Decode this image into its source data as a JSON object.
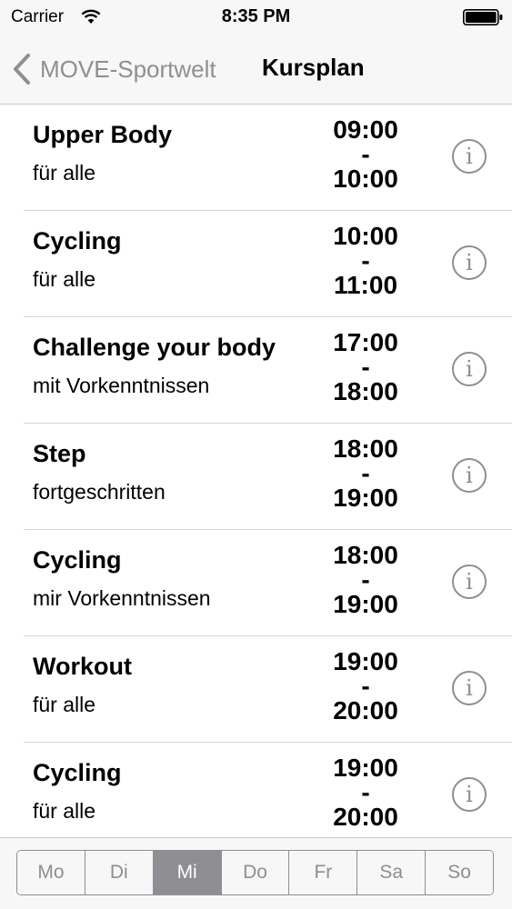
{
  "status_bar": {
    "carrier": "Carrier",
    "time": "8:35 PM"
  },
  "nav": {
    "back_label": "MOVE-Sportwelt",
    "title": "Kursplan"
  },
  "courses": [
    {
      "name": "Upper Body",
      "level": "für alle",
      "start": "09:00",
      "separator": "-",
      "end": "10:00"
    },
    {
      "name": "Cycling",
      "level": "für alle",
      "start": "10:00",
      "separator": "-",
      "end": "11:00"
    },
    {
      "name": "Challenge your body",
      "level": "mit Vorkenntnissen",
      "start": "17:00",
      "separator": "-",
      "end": "18:00"
    },
    {
      "name": "Step",
      "level": "fortgeschritten",
      "start": "18:00",
      "separator": "-",
      "end": "19:00"
    },
    {
      "name": "Cycling",
      "level": "mir Vorkenntnissen",
      "start": "18:00",
      "separator": "-",
      "end": "19:00"
    },
    {
      "name": "Workout",
      "level": "für alle",
      "start": "19:00",
      "separator": "-",
      "end": "20:00"
    },
    {
      "name": "Cycling",
      "level": "für alle",
      "start": "19:00",
      "separator": "-",
      "end": "20:00"
    }
  ],
  "info_glyph": "i",
  "days": {
    "items": [
      "Mo",
      "Di",
      "Mi",
      "Do",
      "Fr",
      "Sa",
      "So"
    ],
    "selected": "Mi"
  },
  "colors": {
    "accent_gray": "#8e8e93",
    "bar_background": "#f7f7f7"
  },
  "icons": {
    "back": "chevron-left-icon",
    "info": "info-icon",
    "wifi": "wifi-icon",
    "battery": "battery-icon"
  }
}
